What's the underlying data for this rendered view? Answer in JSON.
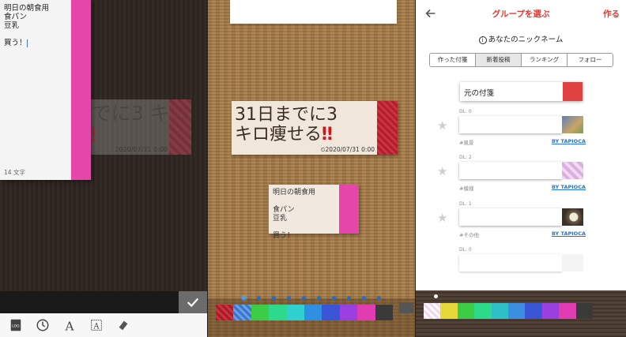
{
  "editor": {
    "note_lines": "明日の朝食用\n食パン\n豆乳\n\n買う！",
    "char_count": "14 文字",
    "ghost_text": "31日までに3\nキロ痩せる",
    "ghost_bang": "‼",
    "ghost_date": "2020/07/31 0:00",
    "confirm_icon": "check-icon",
    "toolbar": [
      {
        "name": "log-icon"
      },
      {
        "name": "clock-icon"
      },
      {
        "name": "font-icon"
      },
      {
        "name": "text-box-icon"
      },
      {
        "name": "eraser-icon"
      }
    ]
  },
  "board": {
    "big_note": {
      "text": "31日までに3\nキロ痩せる",
      "bang": "‼",
      "date": "⏲2020/07/31 0:00",
      "tab_color": "#b0202c"
    },
    "small_note": {
      "text": "明日の朝食用\n\n食パン\n豆乳\n\n買う！",
      "tab_color": "#e546a9"
    },
    "page_dots": 10,
    "active_page": 0,
    "swatches": [
      "#b81f2a",
      "#3a76c9",
      "#3ccc45",
      "#2dd98a",
      "#2fd0d0",
      "#2f8fe0",
      "#3a55d6",
      "#9a3fe0",
      "#e23cb2",
      "#3a3a3a"
    ]
  },
  "group_picker": {
    "title": "グループを選ぶ",
    "action": "作る",
    "nickname_label": "あなたのニックネーム",
    "tabs": [
      "作った付箋",
      "新着投稿",
      "ランキング",
      "フォロー"
    ],
    "active_tab": 1,
    "original_note": "元の付箋",
    "entries": [
      {
        "dl": "DL: 0",
        "tag": "#風景",
        "by": "BY TAPIOCA",
        "thumb": "#9aa7c8"
      },
      {
        "dl": "DL: 2",
        "tag": "#模様",
        "by": "BY TAPIOCA",
        "thumb": "#e8c6e6"
      },
      {
        "dl": "DL: 1",
        "tag": "#その他",
        "by": "BY TAPIOCA",
        "thumb": "#8a7a66"
      },
      {
        "dl": "DL: 0",
        "tag": "",
        "by": "",
        "thumb": "#eeeeee"
      }
    ],
    "swatches": [
      "#f2f2f2",
      "#e6d73a",
      "#3ccc45",
      "#2dd98a",
      "#2fbfc9",
      "#3a8fe0",
      "#3a55d6",
      "#9a3fe0",
      "#e23cb2",
      "#3a3a3a"
    ]
  }
}
